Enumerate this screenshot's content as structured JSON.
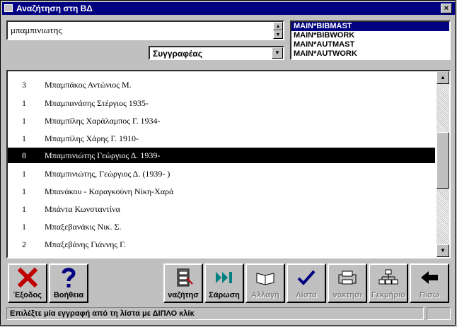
{
  "window": {
    "title": "Αναζήτηση στη ΒΔ",
    "close_label": "×"
  },
  "search": {
    "value": "μπαμπινιωτης"
  },
  "field_select": {
    "value": "Συγγραφέας"
  },
  "databases": [
    {
      "label": "MAIN*BIBMAST",
      "selected": true
    },
    {
      "label": "MAIN*BIBWORK",
      "selected": false
    },
    {
      "label": "MAIN*AUTMAST",
      "selected": false
    },
    {
      "label": "MAIN*AUTWORK",
      "selected": false
    }
  ],
  "results": [
    {
      "count": "3",
      "name": "Μπαμπάκος Αντώνιος Μ."
    },
    {
      "count": "1",
      "name": "Μπαμπανάσης Στέργιος 1935-"
    },
    {
      "count": "1",
      "name": "Μπαμπίλης Χαράλαμπος Γ. 1934-"
    },
    {
      "count": "1",
      "name": "Μπαμπίλης Χάρης Γ. 1910-"
    },
    {
      "count": "8",
      "name": "Μπαμπινιώτης Γεώργιος Δ. 1939-",
      "selected": true
    },
    {
      "count": "1",
      "name": "Μπαμπινιώτης, Γεώργιος Δ. (1939- )"
    },
    {
      "count": "1",
      "name": "Μπανάκου - Καραγκούνη Νίκη-Χαρά"
    },
    {
      "count": "1",
      "name": "Μπάντα Κωνσταντίνα"
    },
    {
      "count": "1",
      "name": "Μπαξεβανάκις Νικ. Σ."
    },
    {
      "count": "2",
      "name": "Μπαξεβάνης Γιάννης Γ."
    }
  ],
  "toolbar": {
    "exit": "Έξοδος",
    "help": "Βοήθεια",
    "search": "ναζήτησ",
    "scan": "Σάρωση",
    "change": "Αλλαγή",
    "list": "Λίστα",
    "retrieve": "νάκτησι",
    "tree": "Γεκμήριο",
    "back": "Πίσω"
  },
  "status": {
    "message": "Επιλέξτε μία εγγραφή από τη λίστα με ΔΙΠΛΟ κλίκ"
  }
}
